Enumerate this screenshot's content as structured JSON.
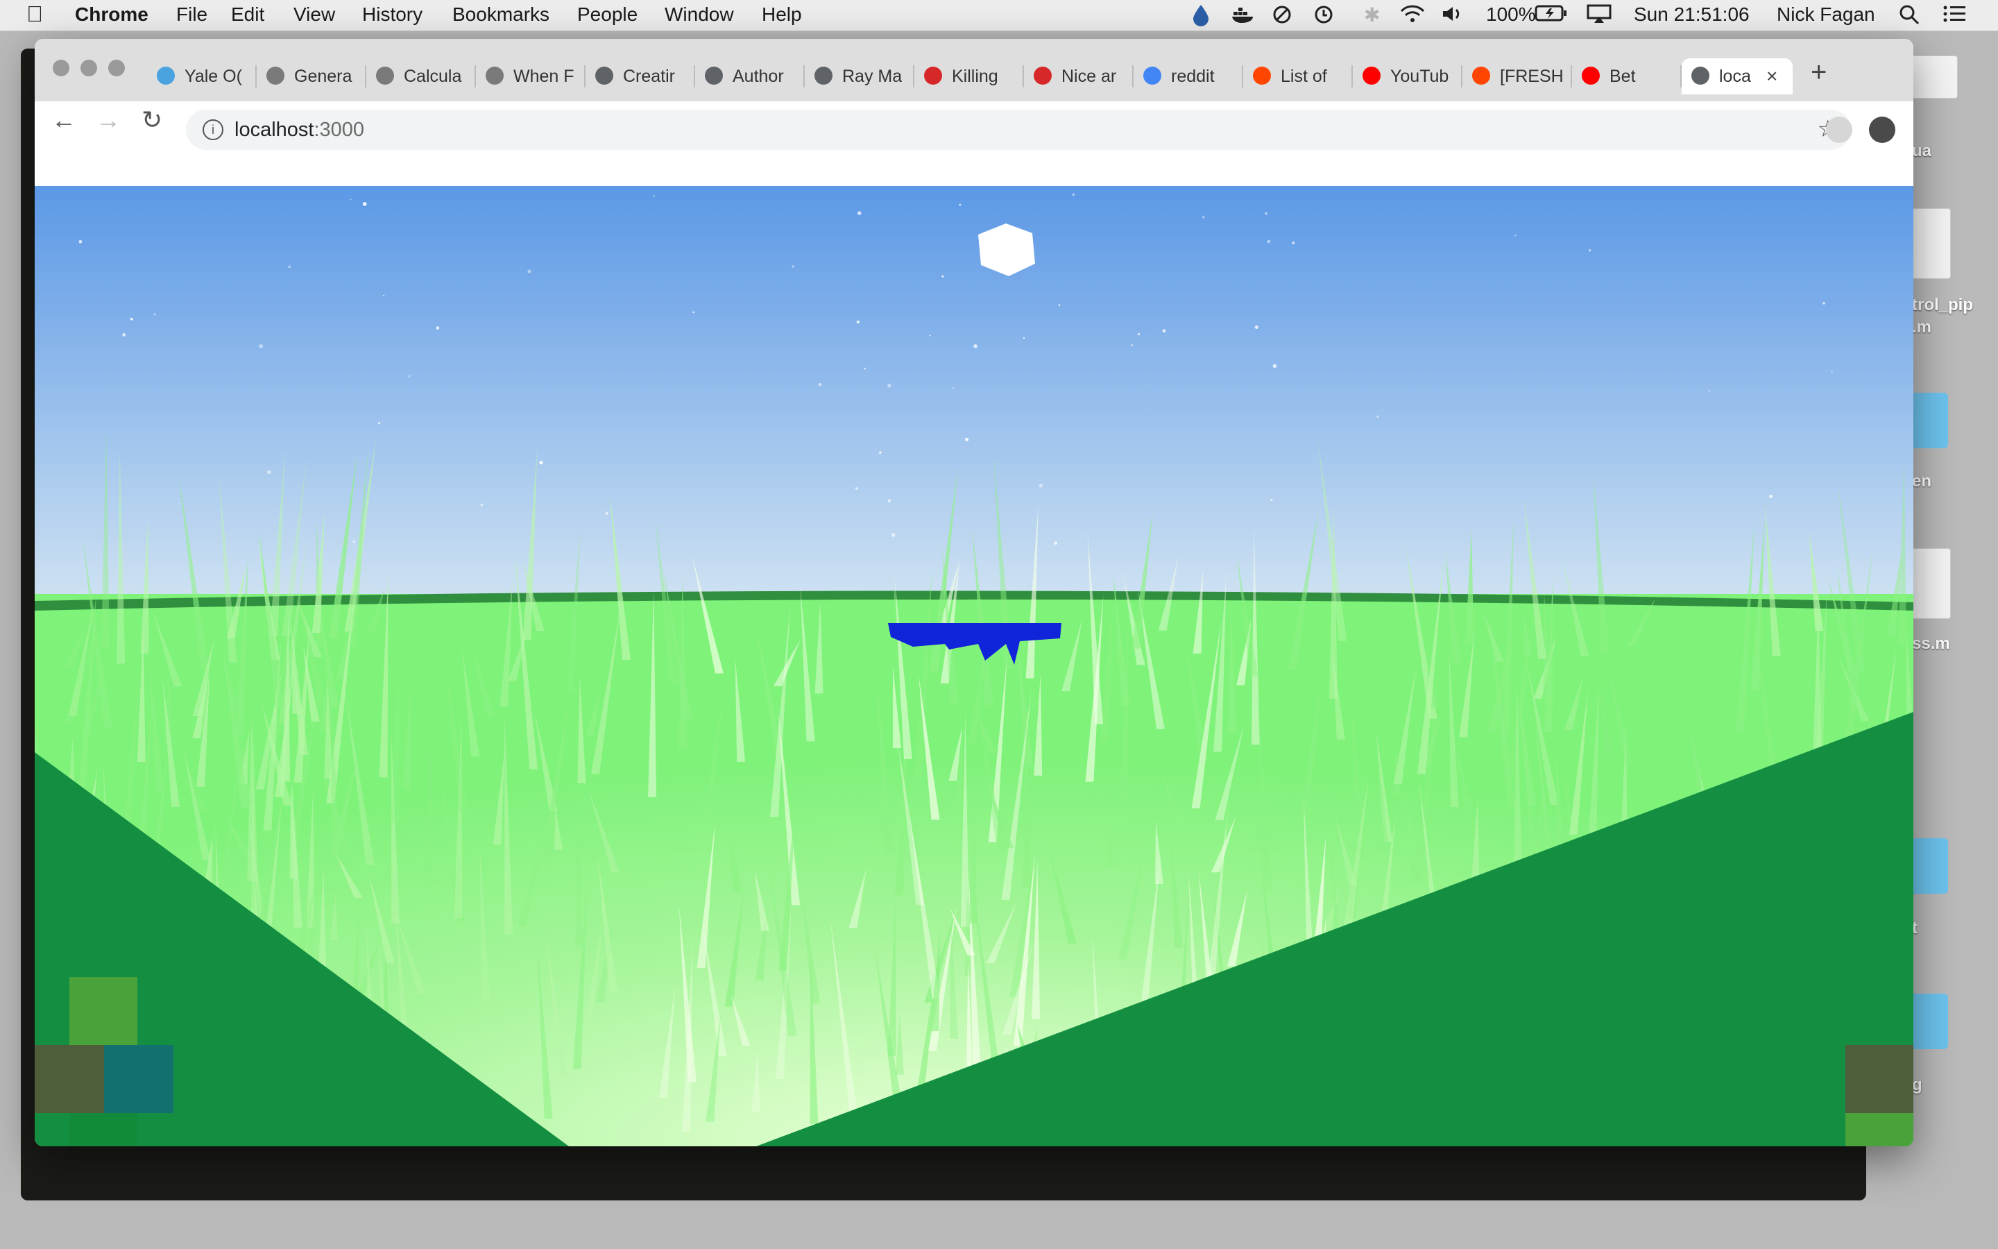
{
  "menubar": {
    "app": "Chrome",
    "items": [
      "File",
      "Edit",
      "View",
      "History",
      "Bookmarks",
      "People",
      "Window",
      "Help"
    ],
    "battery": "100%",
    "clock": "Sun 21:51:06",
    "user": "Nick Fagan"
  },
  "desktop": {
    "labels": [
      "ua",
      "trol_pip",
      ".m",
      "en",
      "ss.m",
      "t",
      "g"
    ]
  },
  "tabs": [
    {
      "label": "Yale O(",
      "favicon": "map-pin-icon",
      "color": "#4aa3df"
    },
    {
      "label": "Genera",
      "favicon": "image-icon",
      "color": "#7a7a7a"
    },
    {
      "label": "Calcula",
      "favicon": "image-icon",
      "color": "#7a7a7a"
    },
    {
      "label": "When F",
      "favicon": "image-icon",
      "color": "#7a7a7a"
    },
    {
      "label": "Creatir",
      "favicon": "globe-icon",
      "color": "#5f6368"
    },
    {
      "label": "Author",
      "favicon": "globe-icon",
      "color": "#5f6368"
    },
    {
      "label": "Ray Ma",
      "favicon": "globe-icon",
      "color": "#5f6368"
    },
    {
      "label": "Killing",
      "favicon": "bbc-america-icon",
      "color": "#d62828"
    },
    {
      "label": "Nice ar",
      "favicon": "bbc-america-icon",
      "color": "#d62828"
    },
    {
      "label": "reddit",
      "favicon": "google-icon",
      "color": "#4285f4"
    },
    {
      "label": "List of",
      "favicon": "reddit-icon",
      "color": "#ff4500"
    },
    {
      "label": "YouTub",
      "favicon": "youtube-icon",
      "color": "#ff0000"
    },
    {
      "label": "[FRESH",
      "favicon": "reddit-icon",
      "color": "#ff4500"
    },
    {
      "label": "Bet",
      "favicon": "youtube-icon",
      "color": "#ff0000"
    },
    {
      "label": "loca",
      "favicon": "globe-icon",
      "color": "#5f6368",
      "active": true
    }
  ],
  "toolbar": {
    "url_host": "localhost",
    "url_port": ":3000"
  },
  "scene": {
    "sky_top": "#5b98e6",
    "sky_bottom": "#cfe2f2",
    "grass_light": "#7ff27a",
    "grass_pale": "#eaffd8",
    "ground_dark": "#148f42",
    "water_color": "#1024d9",
    "sun_color": "#ffffff",
    "minimap_colors": [
      "#4aa33a",
      "#4f5e3a",
      "#12706f",
      "#148f42"
    ]
  }
}
